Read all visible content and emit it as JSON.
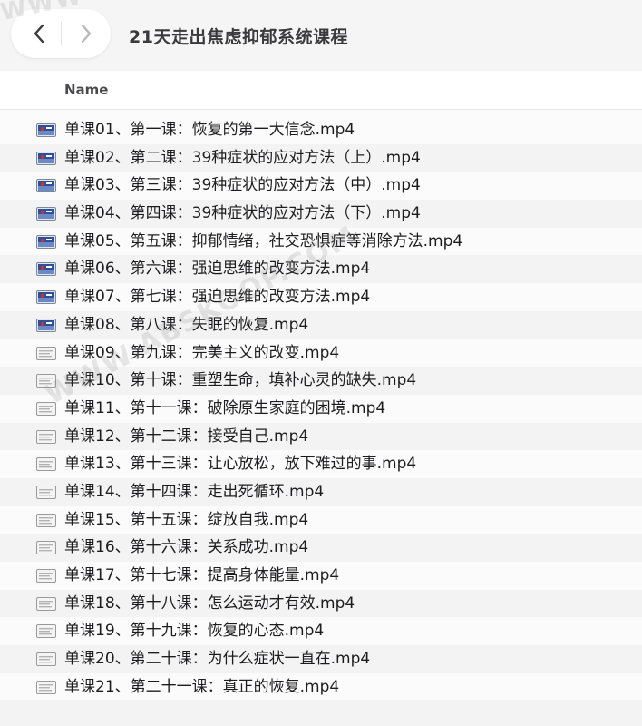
{
  "window": {
    "title": "21天走出焦虑抑郁系统课程"
  },
  "toolbar": {
    "back_icon": "chevron-left-icon",
    "forward_icon": "chevron-right-icon"
  },
  "columns": {
    "name": "Name"
  },
  "files": [
    {
      "name": "单课01、第一课：恢复的第一大信念.mp4",
      "icon": "video-file-icon"
    },
    {
      "name": "单课02、第二课：39种症状的应对方法（上）.mp4",
      "icon": "video-file-icon"
    },
    {
      "name": "单课03、第三课：39种症状的应对方法（中）.mp4",
      "icon": "video-file-icon"
    },
    {
      "name": "单课04、第四课：39种症状的应对方法（下）.mp4",
      "icon": "video-file-icon"
    },
    {
      "name": "单课05、第五课：抑郁情绪，社交恐惧症等消除方法.mp4",
      "icon": "video-file-icon"
    },
    {
      "name": "单课06、第六课：强迫思维的改变方法.mp4",
      "icon": "video-file-icon"
    },
    {
      "name": "单课07、第七课：强迫思维的改变方法.mp4",
      "icon": "video-file-icon"
    },
    {
      "name": "单课08、第八课：失眠的恢复.mp4",
      "icon": "video-file-icon"
    },
    {
      "name": "单课09、第九课：完美主义的改变.mp4",
      "icon": "generic-file-icon"
    },
    {
      "name": "单课10、第十课：重塑生命，填补心灵的缺失.mp4",
      "icon": "generic-file-icon"
    },
    {
      "name": "单课11、第十一课：破除原生家庭的困境.mp4",
      "icon": "generic-file-icon"
    },
    {
      "name": "单课12、第十二课：接受自己.mp4",
      "icon": "generic-file-icon"
    },
    {
      "name": "单课13、第十三课：让心放松，放下难过的事.mp4",
      "icon": "generic-file-icon"
    },
    {
      "name": "单课14、第十四课：走出死循环.mp4",
      "icon": "generic-file-icon"
    },
    {
      "name": "单课15、第十五课：绽放自我.mp4",
      "icon": "generic-file-icon"
    },
    {
      "name": "单课16、第十六课：关系成功.mp4",
      "icon": "generic-file-icon"
    },
    {
      "name": "单课17、第十七课：提高身体能量.mp4",
      "icon": "generic-file-icon"
    },
    {
      "name": "单课18、第十八课：怎么运动才有效.mp4",
      "icon": "generic-file-icon"
    },
    {
      "name": "单课19、第十九课：恢复的心态.mp4",
      "icon": "generic-file-icon"
    },
    {
      "name": "单课20、第二十课：为什么症状一直在.mp4",
      "icon": "generic-file-icon"
    },
    {
      "name": "单课21、第二十一课：真正的恢复.mp4",
      "icon": "generic-file-icon"
    }
  ],
  "watermark": {
    "text_top": "WWW",
    "text_mid": "WWW.ABSKOOP.COM"
  },
  "colors": {
    "row_stripe": "#f3f3f3",
    "video_icon_blue": "#2d4f9e",
    "video_icon_red": "#c0392b"
  }
}
